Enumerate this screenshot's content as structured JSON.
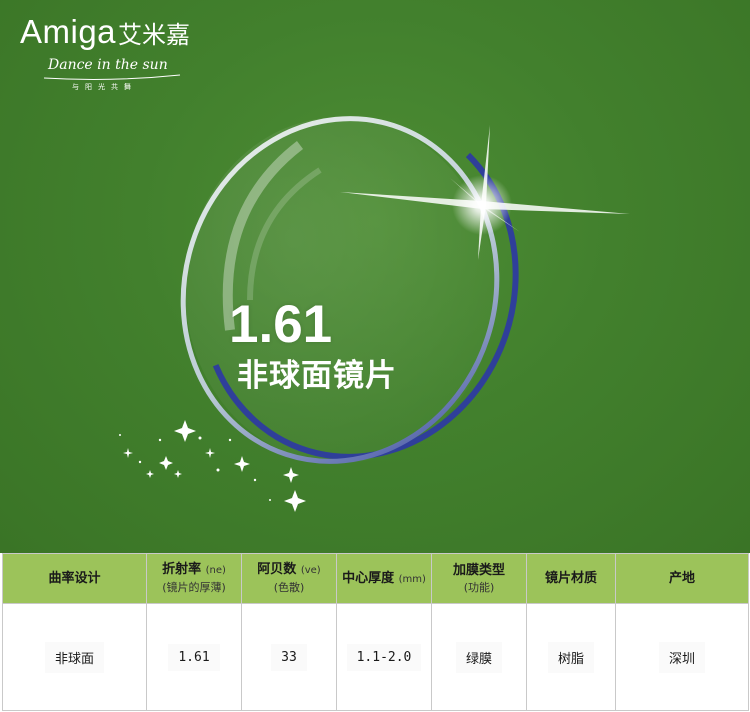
{
  "brand": {
    "latin": "Amiga",
    "chinese": "艾米嘉",
    "slogan": "Dance in the sun",
    "slogan_cn": "与阳光共舞"
  },
  "lens": {
    "index": "1.61",
    "title": "非球面镜片"
  },
  "colors": {
    "banner_green": "#42802d",
    "header_green": "#9cc35a",
    "lens_rim_blue": "#2f3f9a"
  },
  "table": {
    "headers": [
      {
        "main": "曲率设计",
        "unit": "",
        "sub": ""
      },
      {
        "main": "折射率",
        "unit": "(ne)",
        "sub": "(镜片的厚薄)"
      },
      {
        "main": "阿贝数",
        "unit": "(ve)",
        "sub": "(色散)"
      },
      {
        "main": "中心厚度",
        "unit": "(mm)",
        "sub": ""
      },
      {
        "main": "加膜类型",
        "unit": "",
        "sub": "(功能)"
      },
      {
        "main": "镜片材质",
        "unit": "",
        "sub": ""
      },
      {
        "main": "产地",
        "unit": "",
        "sub": ""
      }
    ],
    "row": [
      "非球面",
      "1.61",
      "33",
      "1.1-2.0",
      "绿膜",
      "树脂",
      "深圳"
    ]
  }
}
